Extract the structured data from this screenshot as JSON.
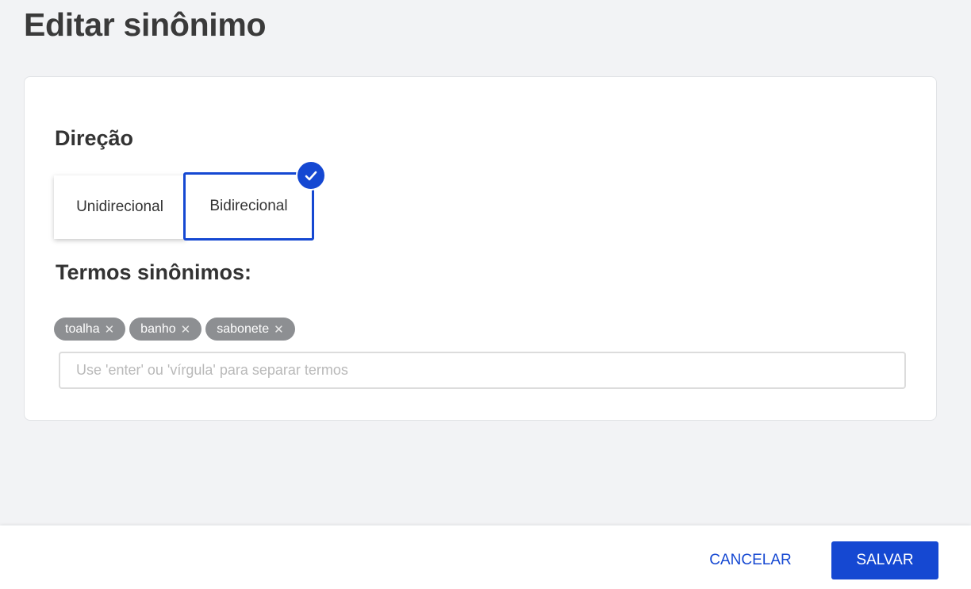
{
  "page": {
    "title": "Editar sinônimo"
  },
  "direction": {
    "title": "Direção",
    "options": [
      {
        "label": "Unidirecional",
        "selected": false
      },
      {
        "label": "Bidirecional",
        "selected": true
      }
    ],
    "accent_color": "#1548d2",
    "selected_icon": "check-icon"
  },
  "terms": {
    "title": "Termos sinônimos:",
    "tags": [
      {
        "label": "toalha",
        "remove_icon": "close-icon"
      },
      {
        "label": "banho",
        "remove_icon": "close-icon"
      },
      {
        "label": "sabonete",
        "remove_icon": "close-icon"
      }
    ],
    "input": {
      "value": "",
      "placeholder": "Use 'enter' ou 'vírgula' para separar termos"
    }
  },
  "footer": {
    "cancel_label": "CANCELAR",
    "save_label": "SALVAR"
  }
}
